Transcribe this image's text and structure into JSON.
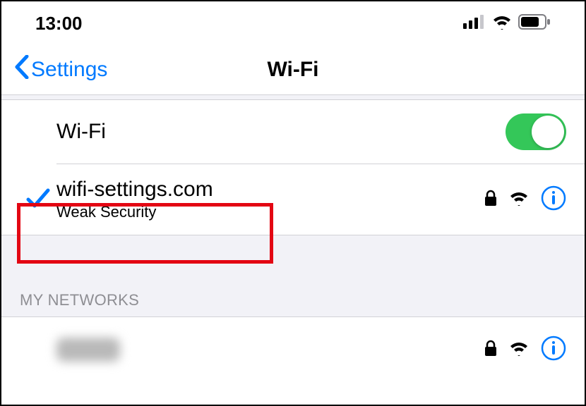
{
  "status": {
    "time": "13:00"
  },
  "nav": {
    "back_label": "Settings",
    "title": "Wi-Fi"
  },
  "wifi_toggle": {
    "label": "Wi-Fi",
    "on": true
  },
  "connected": {
    "name": "wifi-settings.com",
    "subtitle": "Weak Security"
  },
  "sections": {
    "my_networks": "MY NETWORKS"
  },
  "colors": {
    "accent": "#007aff",
    "switch_on": "#34c759",
    "highlight": "#e30613"
  }
}
